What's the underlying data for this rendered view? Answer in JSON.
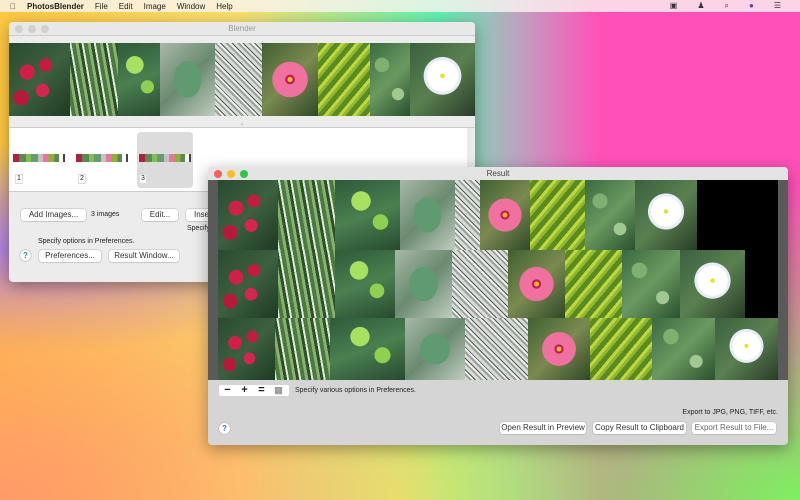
{
  "menubar": {
    "app": "PhotosBlender",
    "items": [
      "File",
      "Edit",
      "Image",
      "Window",
      "Help"
    ],
    "status_icons": [
      "display-icon",
      "user-icon",
      "search-icon",
      "siri-icon",
      "notification-center-icon"
    ]
  },
  "blender": {
    "title": "Blender",
    "thumbnails": [
      {
        "label": "1"
      },
      {
        "label": "2"
      },
      {
        "label": "3",
        "selected": true
      }
    ],
    "add_images": "Add Images...",
    "image_count": "3 images",
    "edit": "Edit...",
    "insert": "Inse",
    "specify_partial": "Specify",
    "options_note": "Specify options in Preferences.",
    "preferences": "Preferences...",
    "result_window": "Result Window...",
    "help": "?"
  },
  "result": {
    "title": "Result",
    "zoom_out": "−",
    "zoom_in": "+",
    "zoom_fit": "=",
    "options_note": "Specify various options in Preferences.",
    "export_note": "Export to JPG, PNG, TIFF, etc.",
    "open_preview": "Open Result in Preview",
    "copy_clipboard": "Copy Result to Clipboard",
    "export_file": "Export Result to File...",
    "help": "?"
  }
}
